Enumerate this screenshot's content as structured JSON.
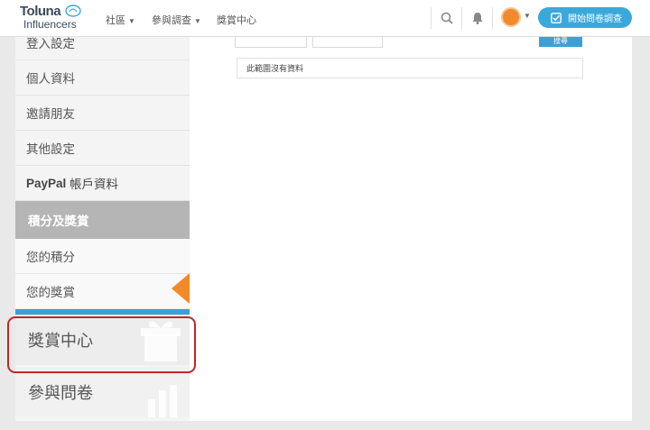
{
  "header": {
    "logo_top": "Toluna",
    "logo_bottom": "Influencers",
    "nav": [
      {
        "label": "社區"
      },
      {
        "label": "參與調查"
      },
      {
        "label": "獎賞中心"
      }
    ],
    "start_button": "開始問卷調查"
  },
  "sidebar": {
    "items": [
      {
        "label": "登入設定"
      },
      {
        "label": "個人資料"
      },
      {
        "label": "邀請朋友"
      },
      {
        "label": "其他設定"
      }
    ],
    "paypal": {
      "bold": "PayPal",
      "rest": " 帳戶資料"
    },
    "section_title": "積分及獎賞",
    "sub_items": [
      {
        "label": "您的積分"
      },
      {
        "label": "您的獎賞"
      }
    ],
    "big_items": [
      {
        "label": "獎賞中心"
      },
      {
        "label": "參與問卷"
      }
    ]
  },
  "main": {
    "search_label": "搜尋",
    "empty_message": "此範圍沒有資料"
  },
  "colors": {
    "accent_blue": "#3ba8dc",
    "active_orange": "#f4892a",
    "highlight_red": "#c0262d",
    "section_gray": "#b5b5b5"
  }
}
